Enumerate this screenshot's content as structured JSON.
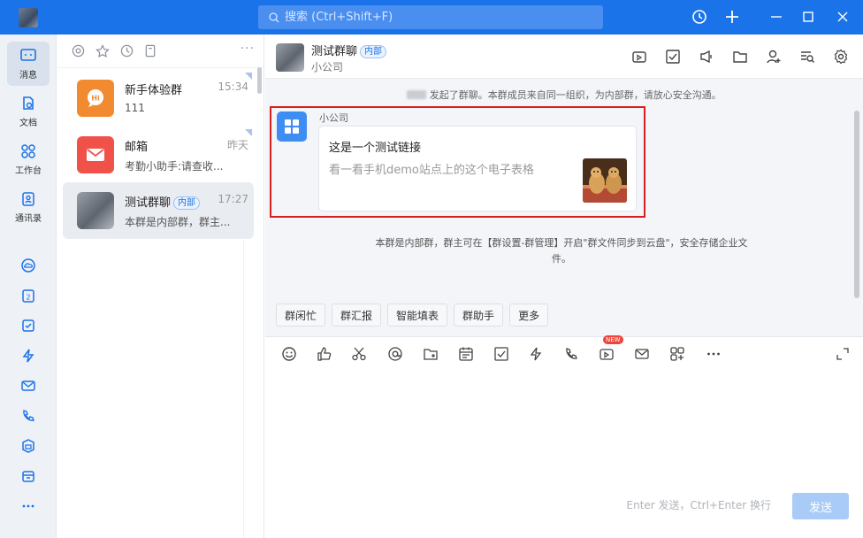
{
  "titlebar": {
    "search_placeholder": "搜索 (Ctrl+Shift+F)",
    "accent": "#1a73e8"
  },
  "leftnav": {
    "items": [
      {
        "label": "消息",
        "icon": "message-icon"
      },
      {
        "label": "文档",
        "icon": "document-icon"
      },
      {
        "label": "工作台",
        "icon": "workbench-icon"
      },
      {
        "label": "通讯录",
        "icon": "contacts-icon"
      }
    ],
    "apps": [
      "cloud-icon",
      "calendar-icon",
      "todo-icon",
      "lightning-icon",
      "mail-icon",
      "phone-icon",
      "cube-icon",
      "drive-icon",
      "more-icon"
    ],
    "calendar_day": "2"
  },
  "sessions": [
    {
      "name": "新手体验群",
      "time": "15:34",
      "preview": "111",
      "color": "#f28b30"
    },
    {
      "name": "邮箱",
      "time": "昨天",
      "preview": "考勤小助手:请查收...",
      "color": "#f0524a"
    },
    {
      "name": "测试群聊",
      "tag": "内部",
      "time": "17:27",
      "preview": "本群是内部群，群主...",
      "active": true
    }
  ],
  "chat": {
    "title": "测试群聊",
    "tag": "内部",
    "subtitle": "小公司",
    "system_msg_1": "发起了群聊。本群成员来自同一组织，为内部群，请放心安全沟通。",
    "message": {
      "sender": "小公司",
      "card_title": "这是一个测试链接",
      "card_desc": "看一看手机demo站点上的这个电子表格"
    },
    "system_msg_2": "本群是内部群，群主可在【群设置-群管理】开启\"群文件同步到云盘\"，安全存储企业文件。",
    "quick_actions": [
      "群闲忙",
      "群汇报",
      "智能填表",
      "群助手",
      "更多"
    ],
    "new_badge": "NEW",
    "input_hint": "Enter 发送，Ctrl+Enter 换行",
    "send_label": "发送"
  }
}
